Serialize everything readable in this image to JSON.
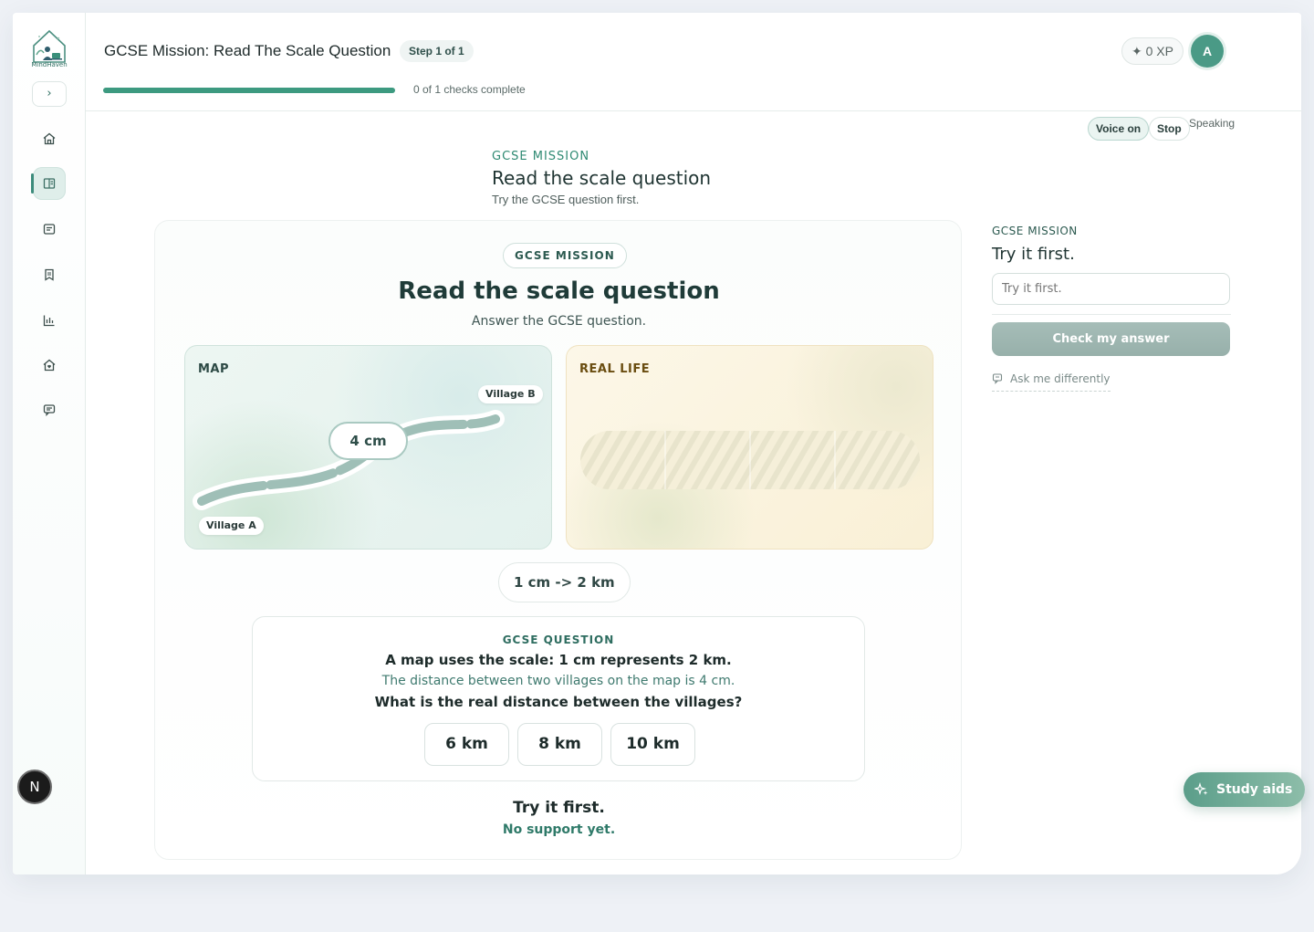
{
  "brand": {
    "name": "MindHaven"
  },
  "header": {
    "title": "GCSE Mission: Read The Scale Question",
    "step": "Step 1 of 1",
    "progress_fraction": 0,
    "progress_text": "0 of 1 checks complete",
    "xp": "✦ 0 XP",
    "avatar_initial": "A"
  },
  "sidebar": {
    "expand": "›",
    "items": [
      {
        "icon": "home-icon"
      },
      {
        "icon": "book-icon",
        "active": true
      },
      {
        "icon": "notes-icon"
      },
      {
        "icon": "bookmark-icon"
      },
      {
        "icon": "chart-icon"
      },
      {
        "icon": "house-heart-icon"
      },
      {
        "icon": "chat-icon"
      }
    ],
    "badge": "N"
  },
  "voice": {
    "on": "Voice on",
    "stop": "Stop",
    "status": "Speaking"
  },
  "main": {
    "eyebrow": "GCSE MISSION",
    "title": "Read the scale question",
    "subtitle": "Try the GCSE question first."
  },
  "card": {
    "tag": "GCSE MISSION",
    "title": "Read the scale question",
    "subtitle": "Answer the GCSE question.",
    "map": {
      "label": "MAP",
      "village_a": "Village A",
      "village_b": "Village B",
      "measure": "4 cm"
    },
    "real": {
      "label": "REAL LIFE"
    },
    "scale": "1 cm -> 2 km",
    "question": {
      "eyebrow": "GCSE QUESTION",
      "line1": "A map uses the scale: 1 cm represents 2 km.",
      "line2": "The distance between two villages on the map is 4 cm.",
      "line3": "What is the real distance between the villages?",
      "options": [
        "6 km",
        "8 km",
        "10 km"
      ]
    },
    "feedback_title": "Try it first.",
    "feedback_sub": "No support yet."
  },
  "rail": {
    "eyebrow": "GCSE MISSION",
    "title": "Try it first.",
    "input_placeholder": "Try it first.",
    "check_button": "Check my answer",
    "ask_link": "Ask me differently"
  },
  "study_aids": "Study aids",
  "colors": {
    "accent": "#3d9a80",
    "brand_dark": "#1f3b38",
    "real_life": "#6a4d10"
  }
}
